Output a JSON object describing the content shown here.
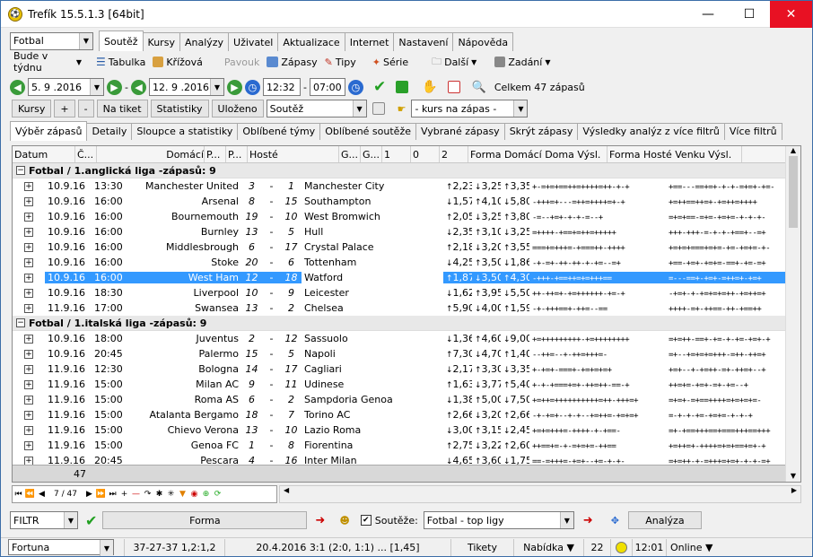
{
  "window": {
    "title": "Trefík 15.5.1.3 [64bit]",
    "minimize": "—",
    "maximize": "☐",
    "close": "✕"
  },
  "sport": {
    "value": "Fotbal"
  },
  "tabs": [
    "Soutěž",
    "Kursy",
    "Analýzy",
    "Uživatel",
    "Aktualizace",
    "Internet",
    "Nastavení",
    "Nápověda"
  ],
  "period": {
    "value": "Bude v týdnu"
  },
  "toolbar": {
    "tabulka": "Tabulka",
    "krizova": "Křížová",
    "pavouk": "Pavouk",
    "zapasy": "Zápasy",
    "tipy": "Tipy",
    "serie": "Série",
    "dalsi": "Další",
    "zadani": "Zadání"
  },
  "dates": {
    "from": "5. 9 .2016",
    "dash": "-",
    "to": "12. 9 .2016",
    "time_from": "12:32",
    "time_dash": "-",
    "time_to": "07:00",
    "total": "Celkem 47 zápasů"
  },
  "buttons": {
    "kursy": "Kursy",
    "plus": "+",
    "minus": "-",
    "na_tiket": "Na tiket",
    "statistiky": "Statistiky",
    "ulozeno": "Uloženo",
    "soutez_sel": "Soutěž",
    "kurs_sel": "- kurs na zápas -"
  },
  "subtabs": [
    "Výběr zápasů",
    "Detaily",
    "Sloupce a statistiky",
    "Oblíbené týmy",
    "Oblíbené soutěže",
    "Vybrané zápasy",
    "Skrýt zápasy",
    "Výsledky analýz z více filtrů",
    "Více filtrů"
  ],
  "columns": [
    "Datum",
    "Č...",
    "Domácí",
    "P...",
    "P...",
    "Hosté",
    "G...",
    "G...",
    "1",
    "0",
    "2",
    "Forma Domácí Doma Výsl.",
    "Forma Hosté Venku Výsl."
  ],
  "groups": [
    {
      "title": "Fotbal / 1.anglická liga -zápasů: 9",
      "rows": [
        [
          "10.9.16",
          "13:30",
          "Manchester United",
          "3",
          "-",
          "1",
          "Manchester City",
          "2,23",
          "3,25",
          "3,35",
          "+-=+=+==++=++++=++-+-+",
          "+==---==+=+-+-+-=+=+-+=-"
        ],
        [
          "10.9.16",
          "16:00",
          "Arsenal",
          "8",
          "-",
          "15",
          "Southampton",
          "1,57",
          "4,10",
          "5,80",
          "-+++=+---=++=++++=+-+",
          "+=++==++=+-+=++=++++"
        ],
        [
          "10.9.16",
          "16:00",
          "Bournemouth",
          "19",
          "-",
          "10",
          "West Bromwich",
          "2,05",
          "3,25",
          "3,80",
          "-=--+=+-+-+-=--+",
          "=+=+==-=+=-+=+=-+-+-+-"
        ],
        [
          "10.9.16",
          "16:00",
          "Burnley",
          "13",
          "-",
          "5",
          "Hull",
          "2,35",
          "3,10",
          "3,25",
          "=++++-+==+=++=+++++",
          "+++-+++-=-+-+-+==+--=+"
        ],
        [
          "10.9.16",
          "16:00",
          "Middlesbrough",
          "6",
          "-",
          "17",
          "Crystal Palace",
          "2,18",
          "3,20",
          "3,55",
          "===+=+++=-+===++-++++",
          "+=+=+===+=+=-+=-+=+=-+-"
        ],
        [
          "10.9.16",
          "16:00",
          "Stoke",
          "20",
          "-",
          "6",
          "Tottenham",
          "4,25",
          "3,50",
          "1,86",
          "-+-=+-++-++-+-+=--=+",
          "+==-+=+-+=+=-==+-+=-=+"
        ],
        [
          "10.9.16",
          "16:00",
          "West Ham",
          "12",
          "-",
          "18",
          "Watford",
          "1,87",
          "3,50",
          "4,30",
          "-+++-+==++=+=+++==",
          "=---==+-+=+-=++=+-+=+"
        ],
        [
          "10.9.16",
          "18:30",
          "Liverpool",
          "10",
          "-",
          "9",
          "Leicester",
          "1,62",
          "3,95",
          "5,50",
          "++-++=+-+=++++++-+=-+",
          "-+=+-+-+=+=+=++-+=++=+"
        ],
        [
          "11.9.16",
          "17:00",
          "Swansea",
          "13",
          "-",
          "2",
          "Chelsea",
          "5,90",
          "4,00",
          "1,59",
          "-+-+++==+-++=--==",
          "++++-=+-++==-++-+==++"
        ]
      ]
    },
    {
      "title": "Fotbal / 1.italská liga -zápasů: 9",
      "rows": [
        [
          "10.9.16",
          "18:00",
          "Juventus",
          "2",
          "-",
          "12",
          "Sassuolo",
          "1,36",
          "4,60",
          "9,00",
          "+=+++++++++-+=++++++++",
          "=+=++-==+-+=-+-+=-+=+-+"
        ],
        [
          "10.9.16",
          "20:45",
          "Palermo",
          "15",
          "-",
          "5",
          "Napoli",
          "7,30",
          "4,70",
          "1,40",
          "--++=--+-++=+++=-",
          "=+--+=+=+=+++-=++-++=+"
        ],
        [
          "11.9.16",
          "12:30",
          "Bologna",
          "14",
          "-",
          "17",
          "Cagliari",
          "2,17",
          "3,30",
          "3,35",
          "+-+=+-===+-+=+=+=+",
          "+=+--+-+=++-=+-++=+--+"
        ],
        [
          "11.9.16",
          "15:00",
          "Milan AC",
          "9",
          "-",
          "11",
          "Udinese",
          "1,63",
          "3,77",
          "5,40",
          "+-+-+===+=+-++=++-==-+",
          "++=+=-+=+-=+-+=--+"
        ],
        [
          "11.9.16",
          "15:00",
          "Roma AS",
          "6",
          "-",
          "2",
          "Sampdoria Genoa",
          "1,38",
          "5,00",
          "7,50",
          "+=++=++++++++++=++-+++=+",
          "=+=+-=+==++++=+=+=+=-"
        ],
        [
          "11.9.16",
          "15:00",
          "Atalanta Bergamo",
          "18",
          "-",
          "7",
          "Torino AC",
          "2,66",
          "3,20",
          "2,66",
          "-+-+=+--+-+--+=++=-+=+=+",
          "=-+-+-+=-+=+=-+-+-+"
        ],
        [
          "11.9.16",
          "15:00",
          "Chievo Verona",
          "13",
          "-",
          "10",
          "Lazio Roma",
          "3,00",
          "3,15",
          "2,45",
          "+=+=+++=-++++-+-+==-",
          "=+-+==+++==+===+++==+++"
        ],
        [
          "11.9.16",
          "15:00",
          "Genoa FC",
          "1",
          "-",
          "8",
          "Fiorentina",
          "2,75",
          "3,22",
          "2,60",
          "++==+=-+-=+=+=-++==",
          "+=++=+-++++=+=+==+=+-+"
        ],
        [
          "11.9.16",
          "20:45",
          "Pescara",
          "4",
          "-",
          "16",
          "Inter Milan",
          "4,65",
          "3,60",
          "1,75",
          "==-=+++=-+=+--+=-+-+-",
          "=+=++-+-=+++=+=+-+-+-=+"
        ]
      ]
    }
  ],
  "footer_count": "47",
  "nav": {
    "page": "7 / 47"
  },
  "bottom": {
    "filtr": "FILTR",
    "forma": "Forma",
    "souteze_label": "Soutěže:",
    "souteze_value": "Fotbal - top ligy",
    "analyza": "Analýza"
  },
  "status": {
    "bookmaker": "Fortuna",
    "record": "37-27-37  1,2:1,2",
    "match": "20.4.2016 3:1 (2:0, 1:1) ... [1,45]",
    "tikety": "Tikety",
    "nabidka": "Nabídka ▼",
    "count": "22",
    "time": "12:01",
    "online": "Online ▼"
  }
}
